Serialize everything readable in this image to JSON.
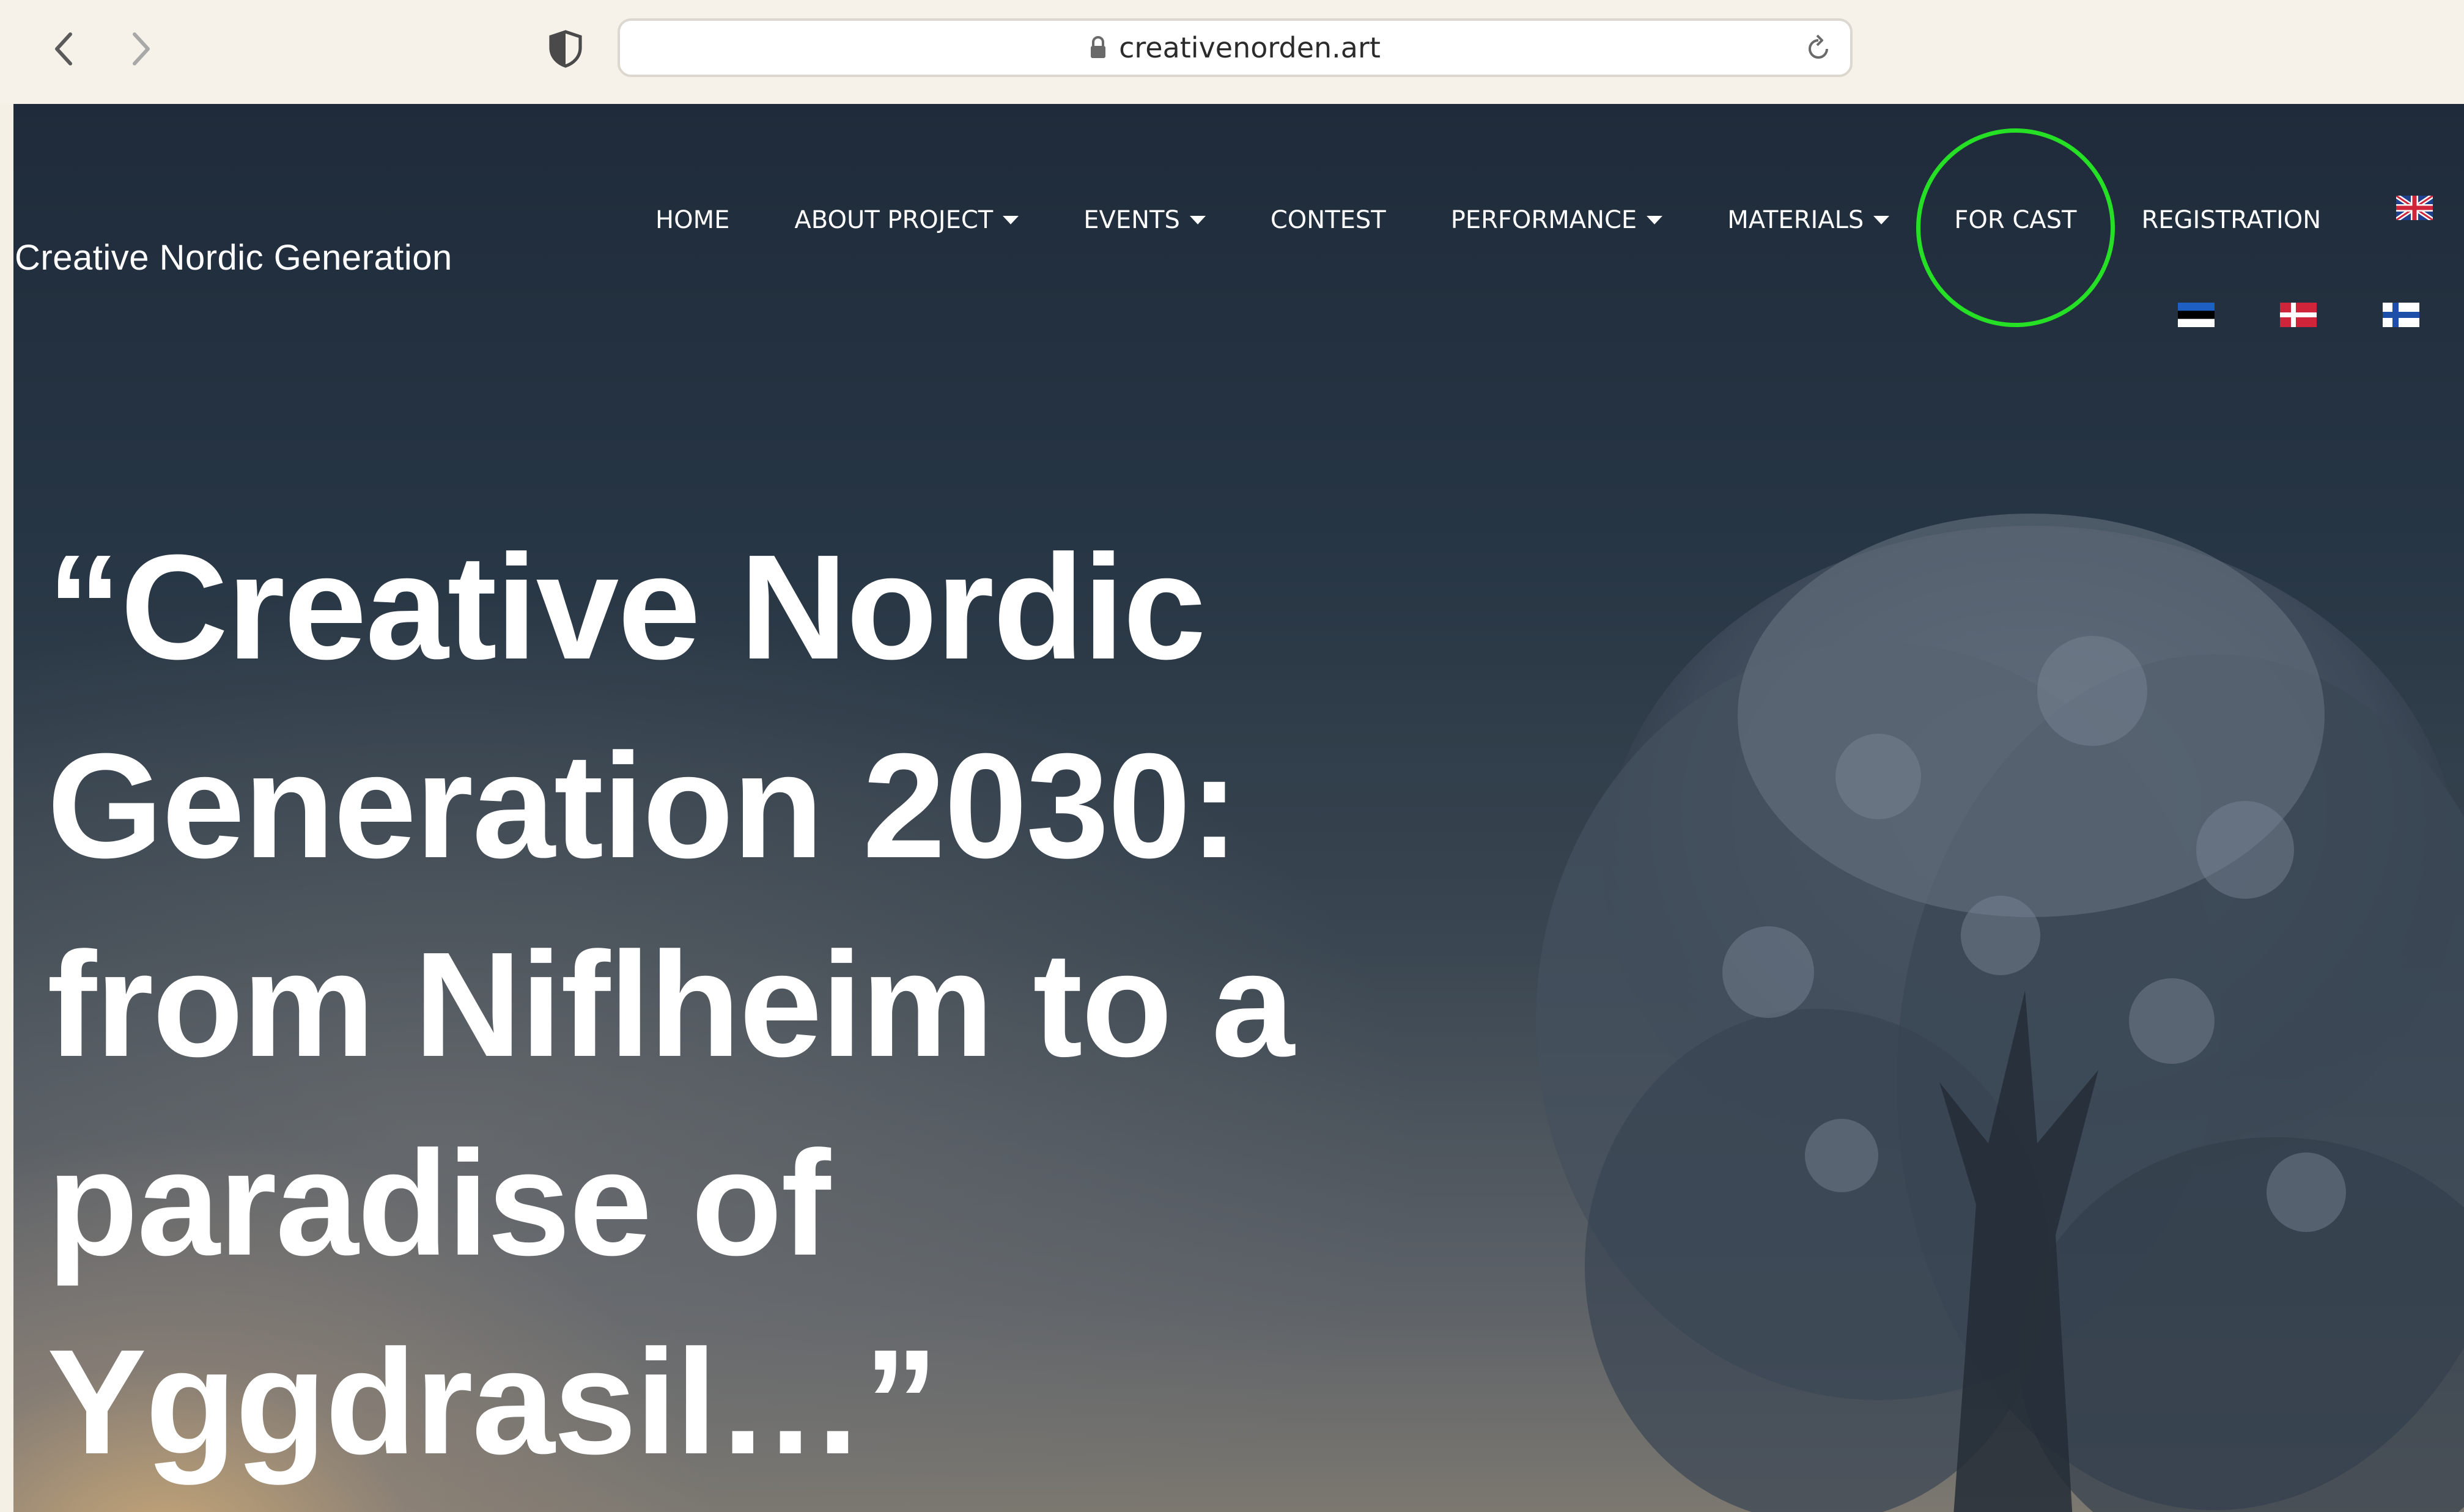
{
  "browser": {
    "url": "creativenorden.art",
    "back_icon": "chevron-left-icon",
    "forward_icon": "chevron-right-icon",
    "privacy_icon": "shield-icon",
    "lock_icon": "lock-icon",
    "reload_icon": "reload-icon"
  },
  "site": {
    "title": "Creative Nordic Generation"
  },
  "menu": {
    "items": [
      {
        "label": "HOME",
        "has_dropdown": false
      },
      {
        "label": "ABOUT PROJECT",
        "has_dropdown": true
      },
      {
        "label": "EVENTS",
        "has_dropdown": true
      },
      {
        "label": "CONTEST",
        "has_dropdown": false
      },
      {
        "label": "PERFORMANCE",
        "has_dropdown": true
      },
      {
        "label": "MATERIALS",
        "has_dropdown": true
      },
      {
        "label": "FOR CAST",
        "has_dropdown": false,
        "highlighted": true
      },
      {
        "label": "REGISTRATION",
        "has_dropdown": false
      }
    ],
    "highlight_color": "#25e025"
  },
  "languages": [
    {
      "code": "en",
      "icon": "uk-flag-icon"
    },
    {
      "code": "et",
      "icon": "estonia-flag-icon"
    },
    {
      "code": "da",
      "icon": "denmark-flag-icon"
    },
    {
      "code": "fi",
      "icon": "finland-flag-icon"
    }
  ],
  "hero": {
    "lines": [
      "“Creative Nordic",
      "Generation 2030:",
      "from Niflheim to a",
      "paradise of",
      "Yggdrasil…”"
    ]
  }
}
